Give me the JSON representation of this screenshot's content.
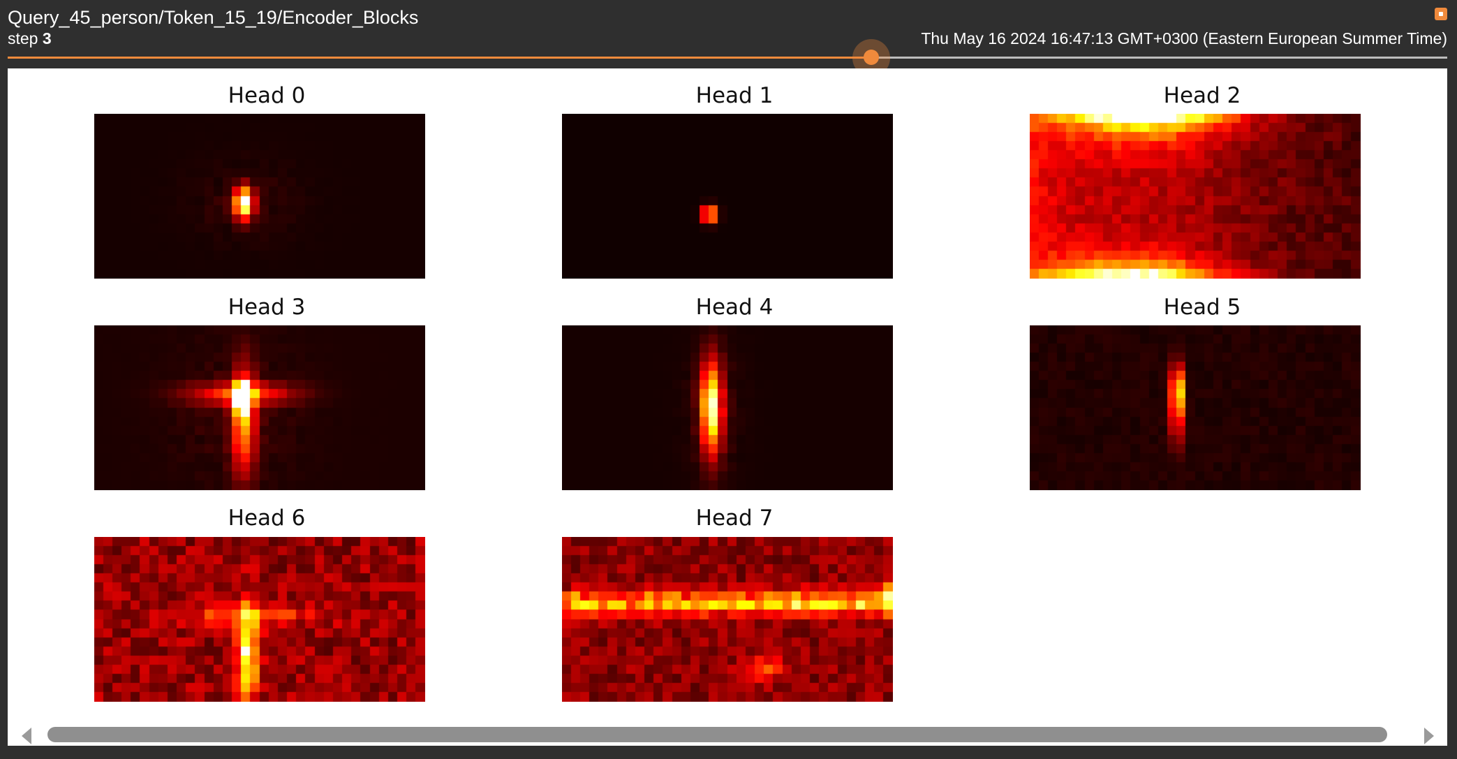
{
  "header": {
    "title": "Query_45_person/Token_15_19/Encoder_Blocks",
    "step_label": "step",
    "step_value": "3",
    "timestamp": "Thu May 16 2024 16:47:13 GMT+0300 (Eastern European Summer Time)"
  },
  "slider": {
    "progress": 0.6
  },
  "colors": {
    "accent": "#f08a3c",
    "chrome_bg": "#2f2f2f",
    "panel_bg": "#ffffff",
    "colormap": "hot"
  },
  "heads": [
    {
      "label": "Head 0",
      "pattern": "focus"
    },
    {
      "label": "Head 1",
      "pattern": "point"
    },
    {
      "label": "Head 2",
      "pattern": "edges"
    },
    {
      "label": "Head 3",
      "pattern": "cross"
    },
    {
      "label": "Head 4",
      "pattern": "vertical"
    },
    {
      "label": "Head 5",
      "pattern": "vertical-thin"
    },
    {
      "label": "Head 6",
      "pattern": "noisy"
    },
    {
      "label": "Head 7",
      "pattern": "band"
    }
  ]
}
